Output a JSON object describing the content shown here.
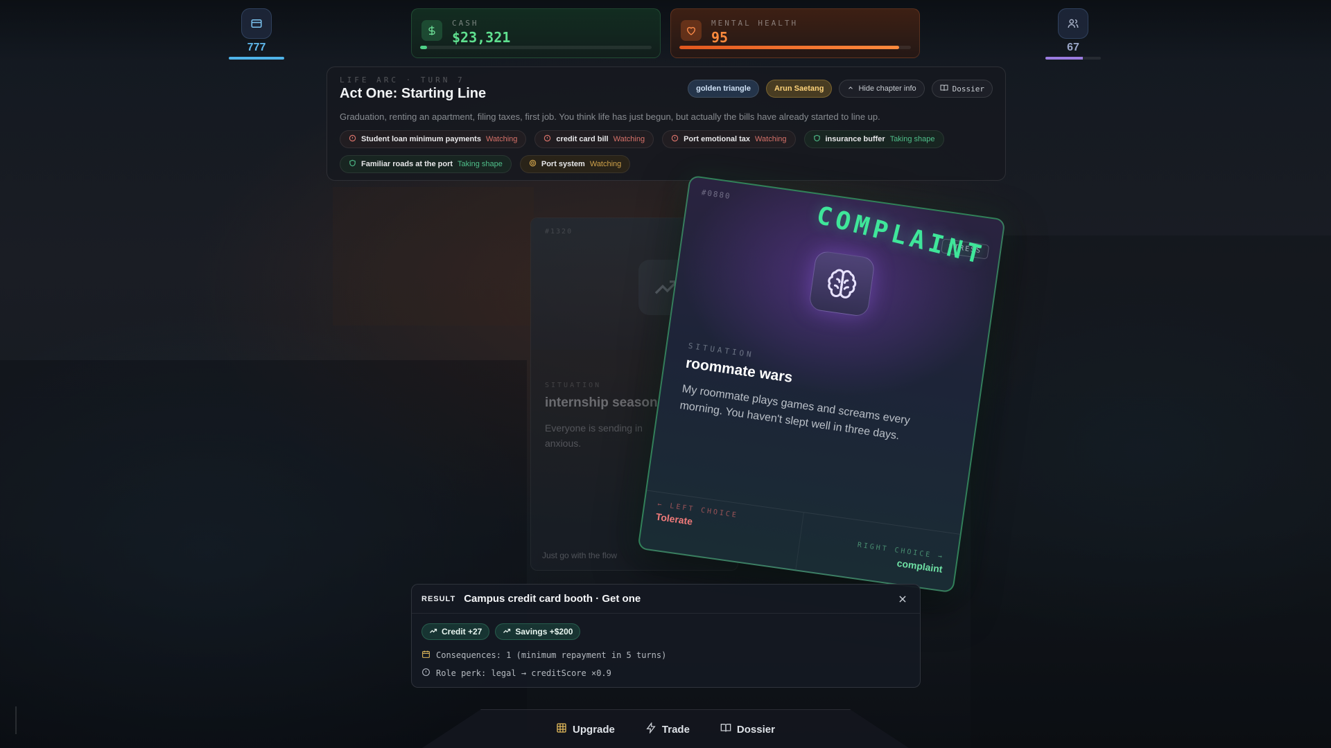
{
  "stats": {
    "left": {
      "value": "777",
      "icon": "wallet-icon",
      "color": "#4fb3e8",
      "fill_fraction": 1.0
    },
    "right": {
      "value": "67",
      "icon": "people-icon",
      "color": "#9a7ce0",
      "fill_fraction": 0.67
    },
    "cash": {
      "label": "CASH",
      "value": "$23,321",
      "icon": "dollar-icon",
      "fill_fraction": 0.03
    },
    "mental_health": {
      "label": "MENTAL HEALTH",
      "value": "95",
      "icon": "heart-icon",
      "fill_fraction": 0.95
    }
  },
  "chapter": {
    "arc_label": "LIFE ARC · TURN 7",
    "title": "Act One: Starting Line",
    "description": "Graduation, renting an apartment, filing taxes, first job. You think life has just begun, but actually the bills have already started to line up.",
    "chips": {
      "region": "golden triangle",
      "character": "Arun Saetang",
      "hide_label": "Hide chapter info",
      "dossier_label": "Dossier"
    },
    "tags": [
      {
        "label": "Student loan minimum payments",
        "status": "Watching",
        "kind": "watch",
        "icon": "alert-icon"
      },
      {
        "label": "credit card bill",
        "status": "Watching",
        "kind": "watch",
        "icon": "alert-icon"
      },
      {
        "label": "Port emotional tax",
        "status": "Watching",
        "kind": "watch",
        "icon": "alert-icon"
      },
      {
        "label": "insurance buffer",
        "status": "Taking shape",
        "kind": "shape",
        "icon": "shield-icon"
      },
      {
        "label": "Familiar roads at the port",
        "status": "Taking shape",
        "kind": "shape",
        "icon": "shield-icon"
      },
      {
        "label": "Port system",
        "status": "Watching",
        "kind": "gold",
        "icon": "target-icon"
      }
    ]
  },
  "back_card": {
    "id": "#1320",
    "situation_label": "SITUATION",
    "title": "internship season",
    "body": "Everyone is sending in anxious.",
    "footer": "Just go with the flow"
  },
  "card": {
    "id": "#0880",
    "stamp": "COMPLAINT",
    "type": "STRESS",
    "icon": "brain-icon",
    "situation_label": "SITUATION",
    "title": "roommate wars",
    "body": "My roommate plays games and screams every morning. You haven't slept well in three days.",
    "left_choice_label": "← LEFT CHOICE",
    "left_choice": "Tolerate",
    "right_choice_label": "RIGHT CHOICE →",
    "right_choice": "complaint"
  },
  "result": {
    "label": "RESULT",
    "title": "Campus credit card booth · Get one",
    "effects": [
      "Credit +27",
      "Savings +$200"
    ],
    "consequences": "Consequences: 1 (minimum repayment in 5 turns)",
    "perk": "Role perk: legal → creditScore ×0.9"
  },
  "nav": {
    "upgrade": "Upgrade",
    "trade": "Trade",
    "dossier": "Dossier"
  }
}
